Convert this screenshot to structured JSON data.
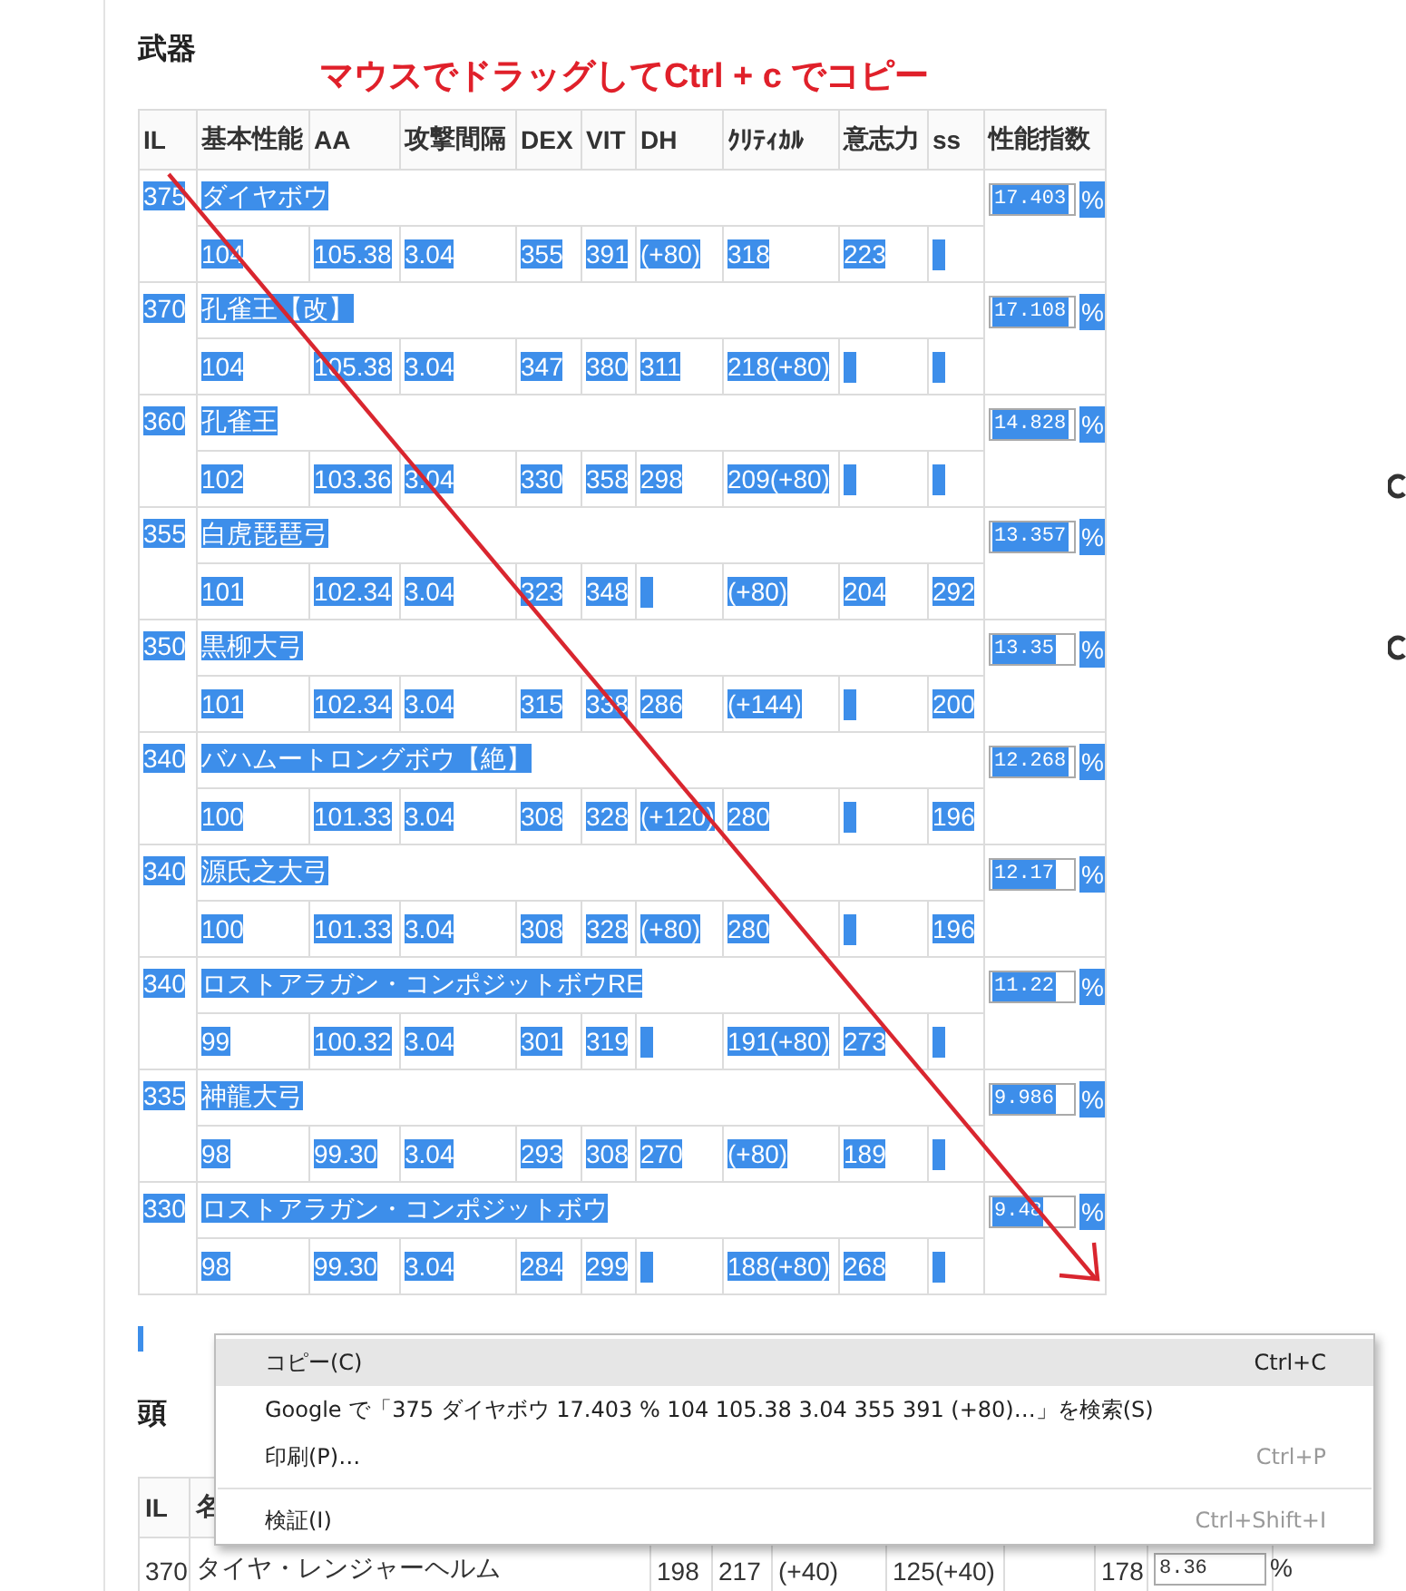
{
  "section_title": "武器",
  "annotation": "マウスでドラッグしてCtrl + c でコピー",
  "weapons_table": {
    "text_selected": true,
    "columns": [
      "IL",
      "基本性能",
      "AA",
      "攻撃間隔",
      "DEX",
      "VIT",
      "DH",
      "ｸﾘﾃｨｶﾙ",
      "意志力",
      "ss",
      "性能指数"
    ],
    "rows": [
      {
        "il": "375",
        "name": "ダイヤボウ",
        "stats": {
          "base": "104",
          "aa": "105.38",
          "interval": "3.04",
          "dex": "355",
          "vit": "391",
          "dh": "(+80)",
          "crit": "318",
          "det": "223"
        },
        "score": "17.403",
        "unit": "%"
      },
      {
        "il": "370",
        "name": "孔雀王【改】",
        "stats": {
          "base": "104",
          "aa": "105.38",
          "interval": "3.04",
          "dex": "347",
          "vit": "380",
          "dh": "311",
          "crit": "218(+80)"
        },
        "score": "17.108",
        "unit": "%"
      },
      {
        "il": "360",
        "name": "孔雀王",
        "stats": {
          "base": "102",
          "aa": "103.36",
          "interval": "3.04",
          "dex": "330",
          "vit": "358",
          "dh": "298",
          "crit": "209(+80)"
        },
        "score": "14.828",
        "unit": "%"
      },
      {
        "il": "355",
        "name": "白虎琵琶弓",
        "stats": {
          "base": "101",
          "aa": "102.34",
          "interval": "3.04",
          "dex": "323",
          "vit": "348",
          "crit": "(+80)",
          "det": "204",
          "ss": "292"
        },
        "score": "13.357",
        "unit": "%"
      },
      {
        "il": "350",
        "name": "黒柳大弓",
        "stats": {
          "base": "101",
          "aa": "102.34",
          "interval": "3.04",
          "dex": "315",
          "vit": "338",
          "dh": "286",
          "crit": "(+144)",
          "ss": "200"
        },
        "score": "13.35",
        "unit": "%"
      },
      {
        "il": "340",
        "name": "バハムートロングボウ【絶】",
        "stats": {
          "base": "100",
          "aa": "101.33",
          "interval": "3.04",
          "dex": "308",
          "vit": "328",
          "dh": "(+120)",
          "crit": "280",
          "ss": "196"
        },
        "score": "12.268",
        "unit": "%"
      },
      {
        "il": "340",
        "name": "源氏之大弓",
        "stats": {
          "base": "100",
          "aa": "101.33",
          "interval": "3.04",
          "dex": "308",
          "vit": "328",
          "dh": "(+80)",
          "crit": "280",
          "ss": "196"
        },
        "score": "12.17",
        "unit": "%"
      },
      {
        "il": "340",
        "name": "ロストアラガン・コンポジットボウRE",
        "stats": {
          "base": "99",
          "aa": "100.32",
          "interval": "3.04",
          "dex": "301",
          "vit": "319",
          "crit": "191(+80)",
          "det": "273"
        },
        "score": "11.22",
        "unit": "%"
      },
      {
        "il": "335",
        "name": "神龍大弓",
        "stats": {
          "base": "98",
          "aa": "99.30",
          "interval": "3.04",
          "dex": "293",
          "vit": "308",
          "dh": "270",
          "crit": "(+80)",
          "det": "189"
        },
        "score": "9.986",
        "unit": "%"
      },
      {
        "il": "330",
        "name": "ロストアラガン・コンポジットボウ",
        "stats": {
          "base": "98",
          "aa": "99.30",
          "interval": "3.04",
          "dex": "284",
          "vit": "299",
          "crit": "188(+80)",
          "det": "268"
        },
        "score": "9.48",
        "unit": "%"
      }
    ]
  },
  "head_section": {
    "title": "頭",
    "columns": [
      "IL",
      "名"
    ],
    "rows": [
      {
        "il": "370",
        "name": "タイヤ・レンジャーヘルム",
        "stats": {
          "column_3": "198",
          "column_4": "217",
          "column_5": "(+40)",
          "column_6": "125(+40)",
          "column_8": "178"
        },
        "score": "8.36",
        "unit": "%"
      }
    ]
  },
  "context_menu": {
    "items": [
      {
        "kind": "item",
        "label": "コピー(C)",
        "shortcut": "Ctrl+C",
        "hovered": true
      },
      {
        "kind": "item",
        "label": "Google で「375 ダイヤボウ  17.403 % 104 105.38 3.04 355 391 (+80)…」を検索(S)",
        "hovered": false
      },
      {
        "kind": "item",
        "label": "印刷(P)…",
        "shortcut": "Ctrl+P",
        "hovered": false
      },
      {
        "kind": "separator"
      },
      {
        "kind": "item",
        "label": "検証(I)",
        "shortcut": "Ctrl+Shift+I",
        "hovered": false
      }
    ]
  }
}
